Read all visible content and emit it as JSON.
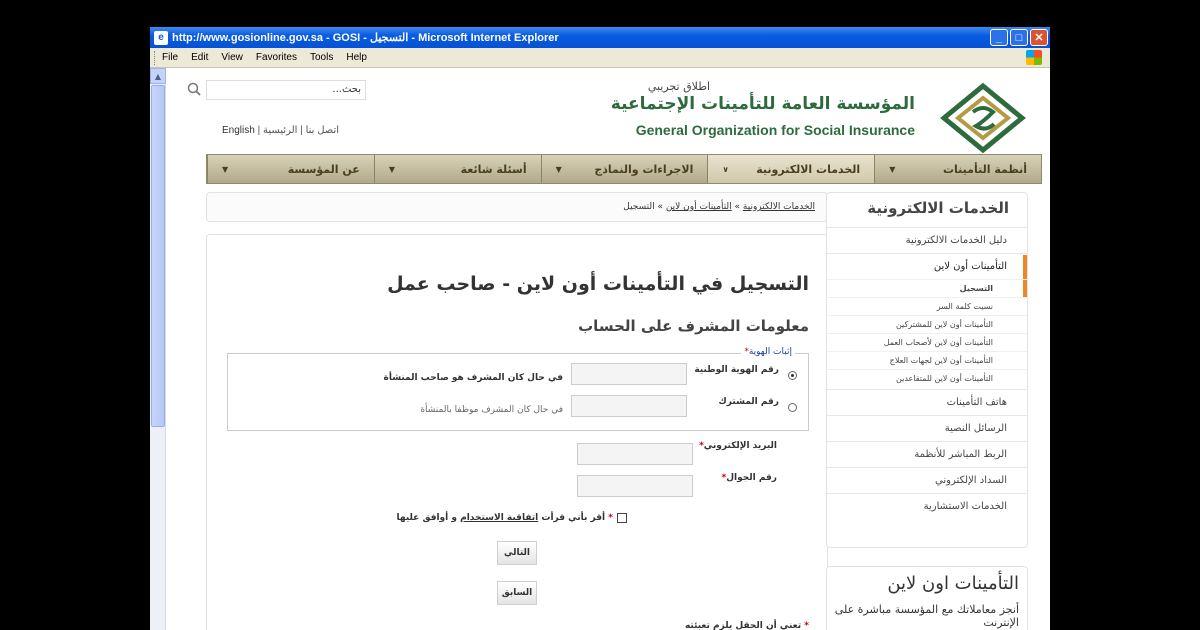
{
  "window": {
    "title": "http://www.gosionline.gov.sa - GOSI - التسجيل - Microsoft Internet Explorer",
    "buttons": {
      "minimize": "_",
      "maximize": "□",
      "close": "✕"
    }
  },
  "menu": [
    "File",
    "Edit",
    "View",
    "Favorites",
    "Tools",
    "Help"
  ],
  "header": {
    "org_name_ar": "المؤسسة العامة للتأمينات الإجتماعية",
    "pilot_badge": "اطلاق تجريبي",
    "org_name_en": "General Organization for Social Insurance",
    "search_placeholder": "بحث...",
    "links": {
      "english": "English",
      "contact": "اتصل بنا",
      "home": "الرئيسية"
    }
  },
  "nav": [
    {
      "label": "أنظمة التأمينات"
    },
    {
      "label": "الخدمات الالكترونية",
      "active": true
    },
    {
      "label": "الاجراءات والنماذج"
    },
    {
      "label": "أسئلة شائعة"
    },
    {
      "label": "عن المؤسسة"
    }
  ],
  "breadcrumb": {
    "items": [
      "الخدمات الالكترونية",
      "التأمينات أون لاين",
      "التسجيل"
    ],
    "sep": " » "
  },
  "form": {
    "title": "التسجيل في التأمينات أون لاين - صاحب عمل",
    "subtitle": "معلومات المشرف على الحساب",
    "identity_legend": "إثبات الهوية",
    "option_national_id": "رقم الهوية الوطنية",
    "option_national_id_hint": "في حال كان المشرف هو صاحب المنشأة",
    "option_subscriber": "رقم المشترك",
    "option_subscriber_hint": "في حال كان المشرف موظفا بالمنشأة",
    "email_label": "البريد الإلكتروني",
    "mobile_label": "رقم الجوال",
    "agree_prefix": "أقر بأني قرأت",
    "agree_link": "اتفاقية الاستخدام",
    "agree_suffix": "و أوافق عليها",
    "next_button": "التالي",
    "prev_button": "السابق",
    "required_note": "تعني أن الحقل يلزم تعبئته",
    "required_mark": "*"
  },
  "sidebar": {
    "title": "الخدمات الالكترونية",
    "items": [
      "دليل الخدمات الالكترونية",
      "التأمينات أون لاين",
      "هاتف التأمينات",
      "الرسائل النصية",
      "الربط المباشر للأنظمة",
      "السداد الإلكتروني",
      "الخدمات الاستشارية"
    ],
    "subitems": [
      "التسجيل",
      "نسيت كلمة السر",
      "التأمينات أون لاين للمشتركين",
      "التأمينات أون لاين لأصحاب العمل",
      "التأمينات أون لاين لجهات العلاج",
      "التأمينات أون لاين للمتقاعدين"
    ]
  },
  "online_box": {
    "title": "التأمينات اون لاين",
    "text": "أنجز معاملاتك مع المؤسسة مباشرة على الإنترنت"
  },
  "colors": {
    "brand_green": "#2d6b3e",
    "accent_orange": "#e98a24",
    "titlebar_blue": "#0a5ce0"
  }
}
